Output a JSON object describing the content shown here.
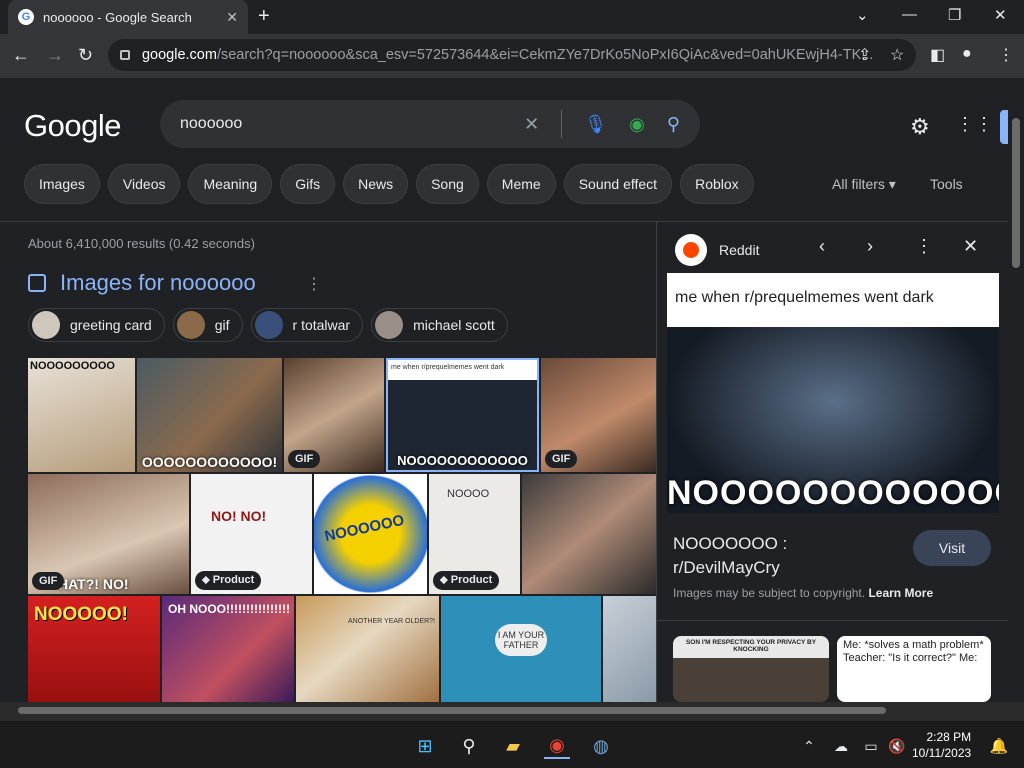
{
  "tab": {
    "title": "noooooo - Google Search"
  },
  "address": {
    "domain": "google.com",
    "path": "/search?q=noooooo&sca_esv=572573644&ei=CekmZYe7DrKo5NoPxI6QiAc&ved=0ahUKEwjH4-TK..."
  },
  "logo": "Google",
  "search": {
    "query": "noooooo"
  },
  "chips": [
    "Images",
    "Videos",
    "Meaning",
    "Gifs",
    "News",
    "Song",
    "Meme",
    "Sound effect",
    "Roblox"
  ],
  "all_filters": "All filters",
  "tools": "Tools",
  "stats": "About 6,410,000 results (0.42 seconds)",
  "images_for": "Images for noooooo",
  "related": [
    "greeting card",
    "gif",
    "r totalwar",
    "michael scott"
  ],
  "tiles": {
    "t1": "NOOOOOOOOO",
    "t2": "OOOOOOOOOOOO!",
    "t4cap": "me when r/prequelmemes went dark",
    "t4": "NOOOOOOOOOOOO",
    "t6": "HAT?! NO!",
    "t7": "NO!  NO!",
    "t8": "NOOOOOO",
    "t9": "NOOOO",
    "t11": "NOOOOO!",
    "t12": "OH NOOO!!!!!!!!!!!!!!!!",
    "t14": "ANOTHER YEAR OLDER?!",
    "t15": "I AM YOUR FATHER"
  },
  "badges": {
    "gif": "GIF",
    "product": "Product"
  },
  "panel": {
    "source": "Reddit",
    "image_caption": "me when r/prequelmemes went dark",
    "image_text": "NOOOOOOOOOOOO",
    "title": "NOOOOOOO : r/DevilMayCry",
    "visit": "Visit",
    "copyright": "Images may be subject to copyright.",
    "learn_more": "Learn More",
    "rel1": "SON I'M RESPECTING YOUR PRIVACY BY KNOCKING",
    "rel2": "Me: *solves a math problem* Teacher: \"Is it correct?\" Me:"
  },
  "clock": {
    "time": "2:28 PM",
    "date": "10/11/2023"
  },
  "colors": {
    "background": "#202124",
    "link": "#8ab4f8",
    "chip_bg": "#303134"
  }
}
